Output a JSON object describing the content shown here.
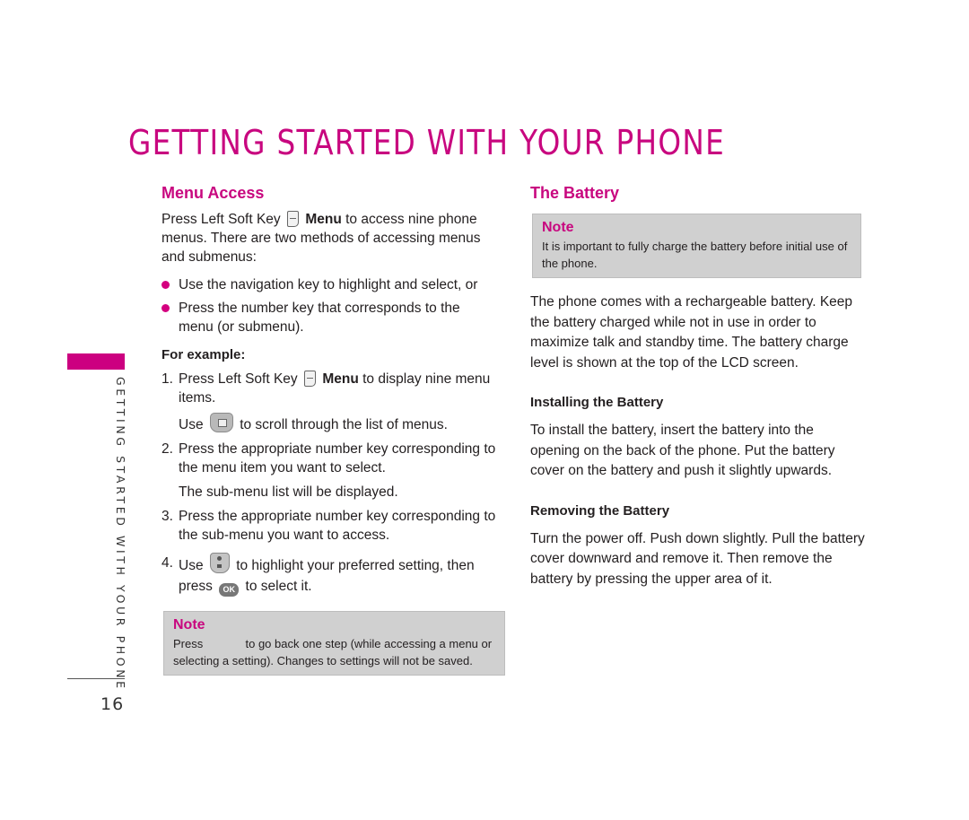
{
  "page": {
    "title": "GETTING STARTED WITH YOUR PHONE",
    "side_label": "GETTING STARTED WITH YOUR PHONE",
    "page_number": "16",
    "accent_color": "#c8077f"
  },
  "menu_access": {
    "heading": "Menu Access",
    "intro_before": "Press Left Soft Key",
    "intro_bold": "Menu",
    "intro_after": "to access nine phone menus. There are two methods of accessing menus and submenus:",
    "bullets": [
      "Use the navigation key to highlight and select, or",
      "Press the number key that corresponds to the menu (or submenu)."
    ],
    "example_label": "For example:",
    "steps": [
      {
        "num": "1.",
        "before": "Press Left Soft Key",
        "bold": "Menu",
        "after": "to display nine menu items.",
        "extra_before": "Use",
        "extra_after": "to scroll through the list of menus."
      },
      {
        "num": "2.",
        "text": "Press the appropriate number key corresponding to the menu item you want to select.",
        "extra": "The sub-menu list will be displayed."
      },
      {
        "num": "3.",
        "text": "Press the appropriate number key corresponding to the sub-menu you want to access."
      },
      {
        "num": "4.",
        "before": "Use",
        "middle": "to highlight your preferred setting, then press",
        "after": "to select it.",
        "ok_label": "OK"
      }
    ],
    "note": {
      "title": "Note",
      "before": "Press",
      "after": "to go back one step (while accessing a menu or selecting a setting). Changes to settings will not be saved."
    }
  },
  "battery": {
    "heading": "The Battery",
    "note": {
      "title": "Note",
      "text": "It is important to fully charge the battery before initial use of the phone."
    },
    "intro": "The phone comes with a rechargeable battery. Keep the battery charged while not in use in order to maximize talk and standby time. The battery charge level is shown at the top of the LCD screen.",
    "installing": {
      "heading": "Installing the Battery",
      "text": "To install the battery, insert the battery into the opening on the back of the phone. Put the battery cover on the battery and push it slightly upwards."
    },
    "removing": {
      "heading": "Removing the Battery",
      "text": "Turn the power off. Push down slightly. Pull the battery cover downward and remove it. Then remove the battery by pressing the upper area of it."
    }
  }
}
